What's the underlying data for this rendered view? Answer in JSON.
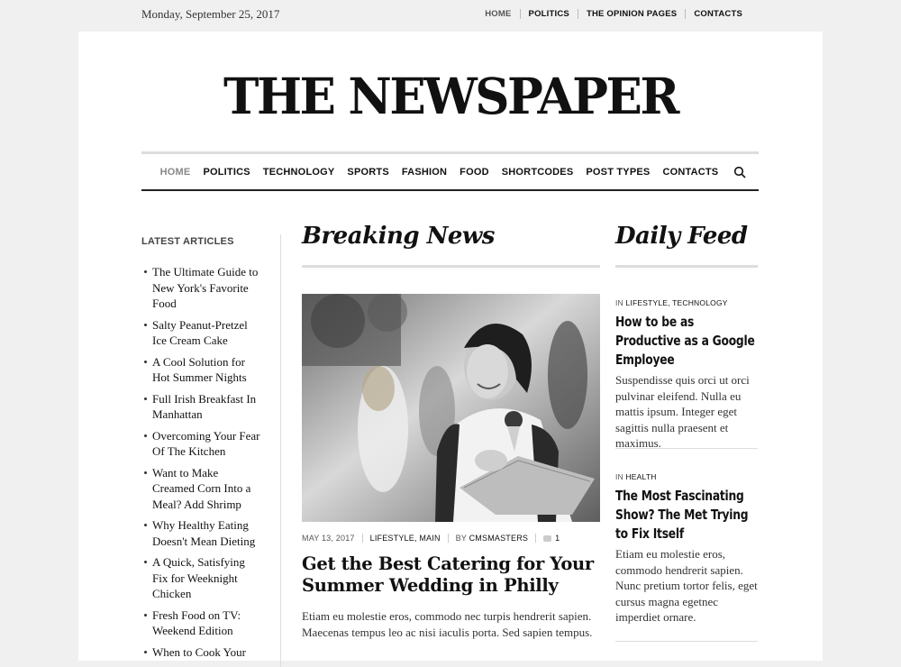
{
  "topbar": {
    "date": "Monday, September 25, 2017",
    "links": [
      "HOME",
      "POLITICS",
      "THE OPINION PAGES",
      "CONTACTS"
    ]
  },
  "site": {
    "logo": "THE NEWSPAPER"
  },
  "mainnav": {
    "items": [
      "HOME",
      "POLITICS",
      "TECHNOLOGY",
      "SPORTS",
      "FASHION",
      "FOOD",
      "SHORTCODES",
      "POST TYPES",
      "CONTACTS"
    ],
    "active": "HOME",
    "search_icon": "search-icon"
  },
  "sidebar": {
    "heading": "LATEST ARTICLES",
    "articles": [
      "The Ultimate Guide to New York's Favorite Food",
      "Salty Peanut-Pretzel Ice Cream Cake",
      "A Cool Solution for Hot Summer Nights",
      "Full Irish Breakfast In Manhattan",
      "Overcoming Your Fear Of The Kitchen",
      "Want to Make Creamed Corn Into a Meal? Add Shrimp",
      "Why Healthy Eating Doesn't Mean Dieting",
      "A Quick, Satisfying Fix for Weeknight Chicken",
      "Fresh Food on TV: Weekend Edition",
      "When to Cook Your"
    ]
  },
  "breaking": {
    "title": "Breaking News",
    "meta": {
      "date": "MAY 13, 2017",
      "cat1": "LIFESTYLE",
      "cat_sep": ", ",
      "cat2": "MAIN",
      "by": "BY ",
      "author": "CMSMASTERS",
      "comments": "1"
    },
    "headline": "Get the Best Catering for Your Summer Wedding in Philly",
    "excerpt": "Etiam eu molestie eros, commodo nec turpis hendrerit sapien. Maecenas tempus leo ac nisi iaculis porta. Sed sapien tempus."
  },
  "feed": {
    "title": "Daily Feed",
    "items": [
      {
        "in": "IN ",
        "cats": "LIFESTYLE, TECHNOLOGY",
        "title": "How to be as Productive as a Google Employee",
        "text": "Suspendisse quis orci ut orci pulvinar eleifend. Nulla eu mattis ipsum. Integer eget sagittis nulla praesent et maximus."
      },
      {
        "in": "IN ",
        "cats": "HEALTH",
        "title": "The Most Fascinating Show? The Met Trying to Fix Itself",
        "text": "Etiam eu molestie eros, commodo hendrerit sapien. Nunc pretium tortor felis, eget cursus magna egetnec imperdiet ornare."
      }
    ]
  }
}
